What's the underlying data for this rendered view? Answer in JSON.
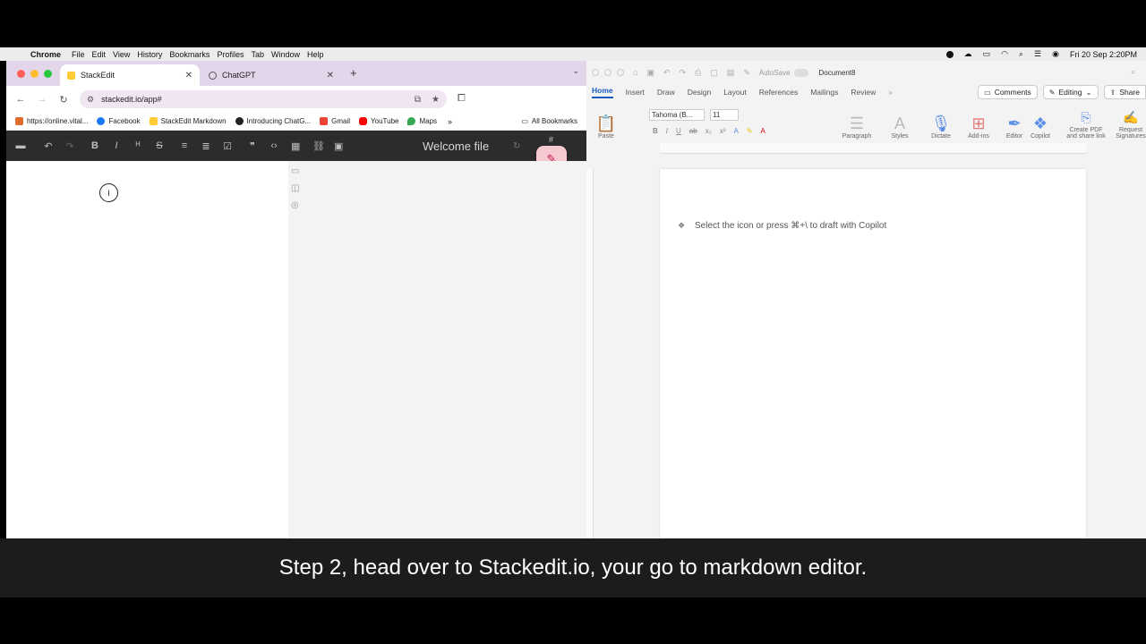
{
  "menubar": {
    "apple_icon": "apple-icon",
    "app": "Chrome",
    "items": [
      "File",
      "Edit",
      "View",
      "History",
      "Bookmarks",
      "Profiles",
      "Tab",
      "Window",
      "Help"
    ],
    "clock": "Fri 20 Sep  2:20PM"
  },
  "chrome": {
    "tabs": [
      {
        "label": "StackEdit",
        "active": true
      },
      {
        "label": "ChatGPT",
        "active": false
      }
    ],
    "url": "stackedit.io/app#",
    "bookmarks": [
      {
        "label": "https://online.vital...",
        "color": "#e06b2b"
      },
      {
        "label": "Facebook",
        "color": "#1877f2"
      },
      {
        "label": "StackEdit Markdown",
        "color": "#ffcc33"
      },
      {
        "label": "Introducing ChatG...",
        "color": "#222222"
      },
      {
        "label": "Gmail",
        "color": "#ea4335"
      },
      {
        "label": "YouTube",
        "color": "#ff0000"
      },
      {
        "label": "Maps",
        "color": "#34a853"
      }
    ],
    "more_bookmarks": "»",
    "all_bookmarks": "All Bookmarks"
  },
  "stackedit": {
    "file_title": "Welcome file",
    "hash_badge": "#"
  },
  "word": {
    "autosave": "AutoSave",
    "doc_title": "Document8",
    "tabs": [
      "Home",
      "Insert",
      "Draw",
      "Design",
      "Layout",
      "References",
      "Mailings",
      "Review"
    ],
    "actions": {
      "comments": "Comments",
      "editing": "Editing",
      "share": "Share"
    },
    "font": "Tahoma (B...",
    "size": "11",
    "ribbon": {
      "paste": "Paste",
      "paragraph": "Paragraph",
      "styles": "Styles",
      "dictate": "Dictate",
      "addins": "Add-ins",
      "editor": "Editor",
      "copilot": "Copilot",
      "create_pdf_1": "Create PDF",
      "create_pdf_2": "and share link",
      "request_sig_1": "Request",
      "request_sig_2": "Signatures"
    },
    "copilot_hint": "Select the icon or press ⌘+\\ to draft with Copilot"
  },
  "caption": "Step 2, head over to Stackedit.io, your go to markdown editor."
}
